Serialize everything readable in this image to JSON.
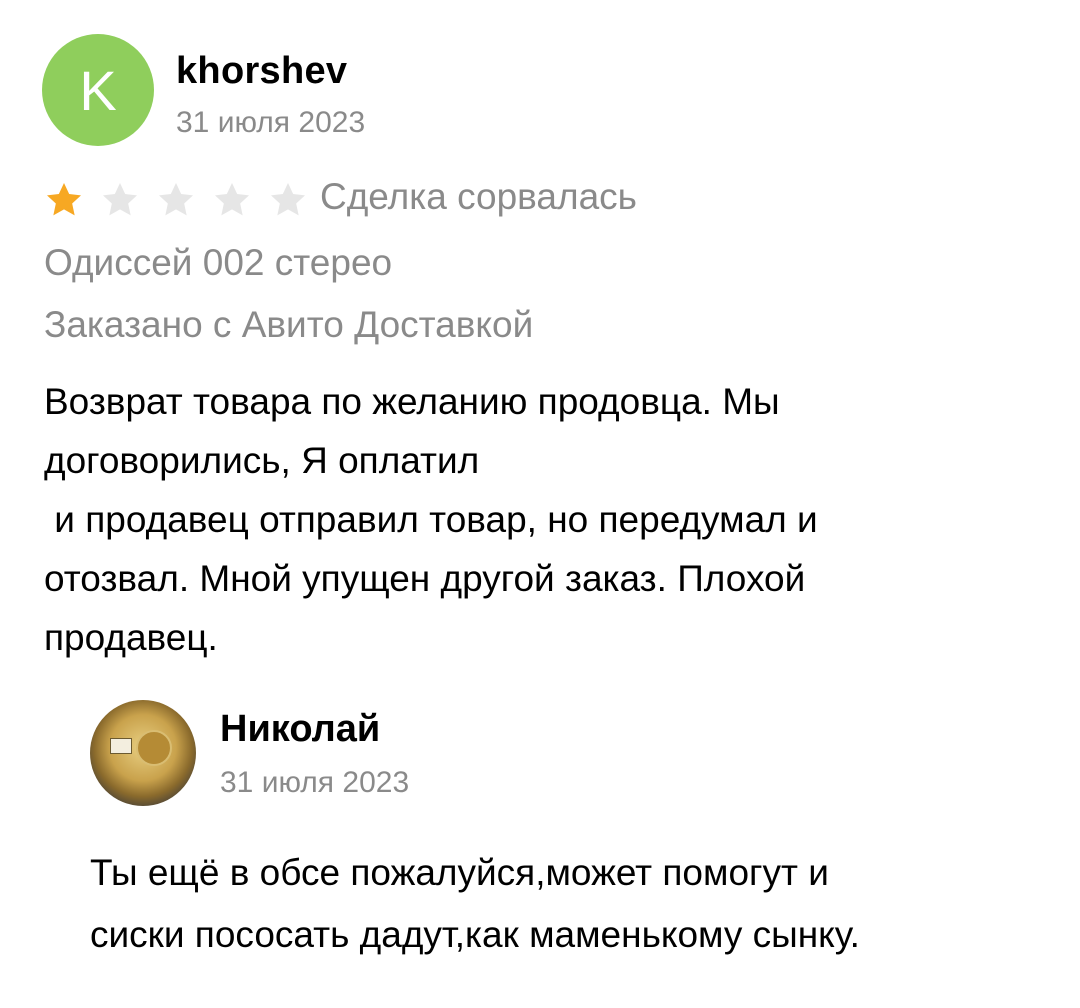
{
  "review": {
    "avatar_letter": "K",
    "avatar_color": "#8fce5c",
    "author": "khorshev",
    "date": "31 июля 2023",
    "rating": 1,
    "rating_max": 5,
    "star_color_filled": "#f7a823",
    "star_color_empty": "#e6e6e6",
    "deal_status": "Сделка сорвалась",
    "product": "Одиссей 002 стерео",
    "delivery": "Заказано с Авито Доставкой",
    "text_lines": [
      "Возврат товара по желанию продовца. Мы",
      "договорились, Я оплатил",
      " и продавец отправил товар, но передумал и",
      "отозвал. Мной упущен другой заказ. Плохой",
      "продавец."
    ]
  },
  "reply": {
    "author": "Николай",
    "date": "31 июля 2023",
    "avatar_icon": "gold-coin-avatar",
    "text_lines": [
      "Ты ещё в обсе пожалуйся,может помогут и",
      "сиски пососать дадут,как маменькому сынку."
    ]
  }
}
